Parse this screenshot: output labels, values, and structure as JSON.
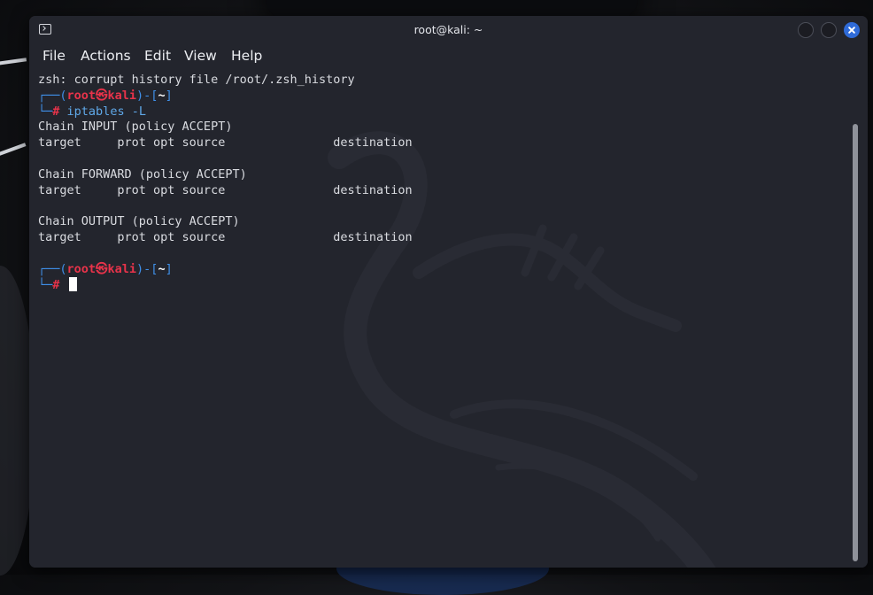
{
  "window": {
    "title": "root@kali: ~"
  },
  "menu": [
    {
      "label": "File"
    },
    {
      "label": "Actions"
    },
    {
      "label": "Edit"
    },
    {
      "label": "View"
    },
    {
      "label": "Help"
    }
  ],
  "terminal": {
    "warning": "zsh: corrupt history file /root/.zsh_history",
    "prompt": {
      "top_open": "┌──(",
      "user": "root",
      "at": "㉿",
      "host": "kali",
      "mid": ")-[",
      "dir": "~",
      "close": "]",
      "bottom": "└─",
      "hash": "#"
    },
    "command": "iptables -L",
    "output": [
      "Chain INPUT (policy ACCEPT)",
      "target     prot opt source               destination",
      "",
      "Chain FORWARD (policy ACCEPT)",
      "target     prot opt source               destination",
      "",
      "Chain OUTPUT (policy ACCEPT)",
      "target     prot opt source               destination",
      ""
    ]
  },
  "colors": {
    "window_bg": "#23252d",
    "prompt_frame": "#3f8fe8",
    "prompt_user": "#e8334a",
    "close_button": "#2f6bd8"
  }
}
